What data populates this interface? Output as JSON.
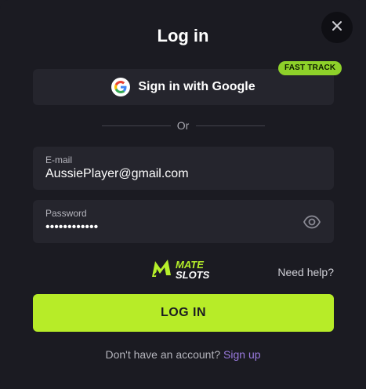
{
  "modal": {
    "title": "Log in",
    "close_icon": "close-icon"
  },
  "google": {
    "label": "Sign in with Google",
    "icon": "google-icon",
    "badge": "FAST TRACK",
    "badge_color": "#8ed12a"
  },
  "divider": {
    "text": "Or"
  },
  "email": {
    "label": "E-mail",
    "value": "AussiePlayer@gmail.com"
  },
  "password": {
    "label": "Password",
    "value": "••••••••••••",
    "toggle_icon": "eye-icon"
  },
  "brand": {
    "line1": "MATE",
    "line2": "SLOTS",
    "accent": "#b6f02a"
  },
  "help": {
    "label": "Need help?"
  },
  "login_button": {
    "label": "LOG IN",
    "color": "#b7ec28"
  },
  "footer": {
    "text": "Don't have an account?",
    "link": "Sign up",
    "link_color": "#9b7be0"
  }
}
